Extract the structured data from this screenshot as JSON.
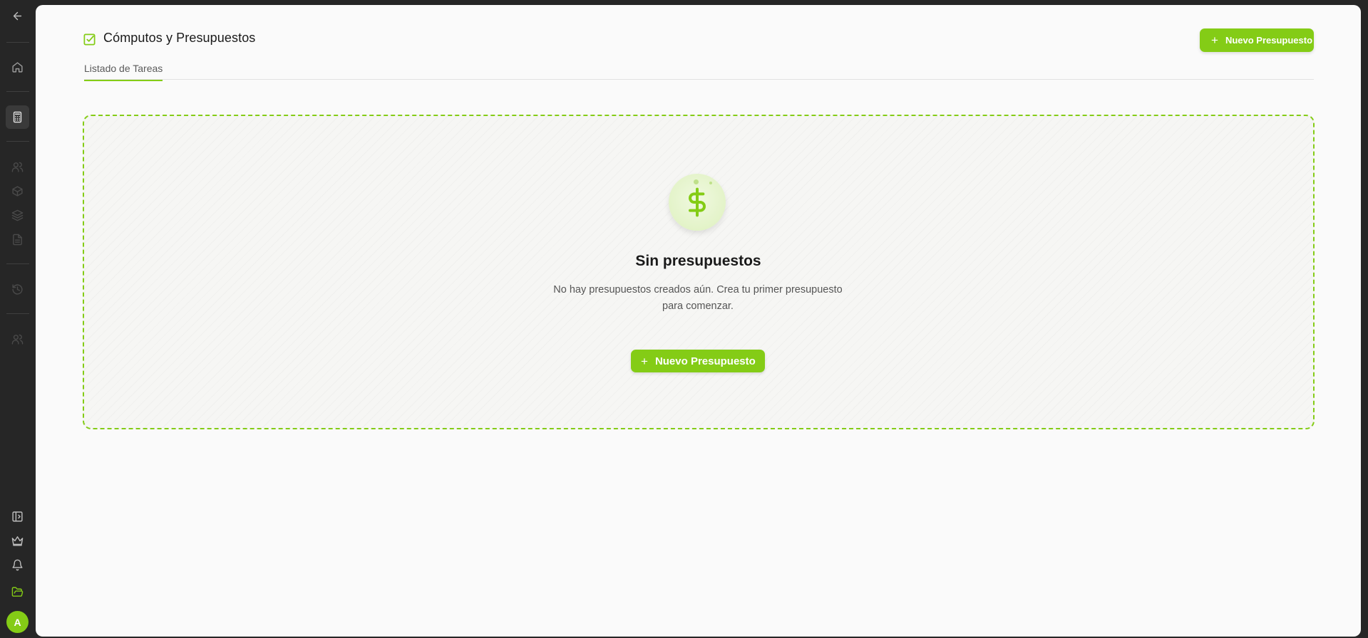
{
  "header": {
    "title": "Cómputos y Presupuestos",
    "new_button_label": "Nuevo Presupuesto"
  },
  "tabs": [
    {
      "label": "Listado de Tareas",
      "active": true
    }
  ],
  "empty_state": {
    "title": "Sin presupuestos",
    "description": "No hay presupuestos creados aún. Crea tu primer presupuesto para comenzar.",
    "button_label": "Nuevo Presupuesto",
    "icon": "dollar-icon"
  },
  "sidebar": {
    "items": [
      {
        "icon": "back-arrow-icon",
        "active": false
      },
      {
        "icon": "home-icon",
        "active": false
      },
      {
        "icon": "calculator-icon",
        "active": true
      },
      {
        "icon": "users-icon",
        "active": false
      },
      {
        "icon": "box-icon",
        "active": false
      },
      {
        "icon": "layers-icon",
        "active": false
      },
      {
        "icon": "document-icon",
        "active": false
      },
      {
        "icon": "history-icon",
        "active": false
      },
      {
        "icon": "team-icon",
        "active": false
      },
      {
        "icon": "sidebar-toggle-icon",
        "active": false
      },
      {
        "icon": "crown-icon",
        "active": false
      },
      {
        "icon": "bell-icon",
        "active": false
      },
      {
        "icon": "folder-open-icon",
        "active": false
      }
    ],
    "avatar_initial": "A"
  },
  "colors": {
    "accent": "#84cc16",
    "sidebar_bg": "#262626",
    "panel_bg": "#fafafa"
  }
}
